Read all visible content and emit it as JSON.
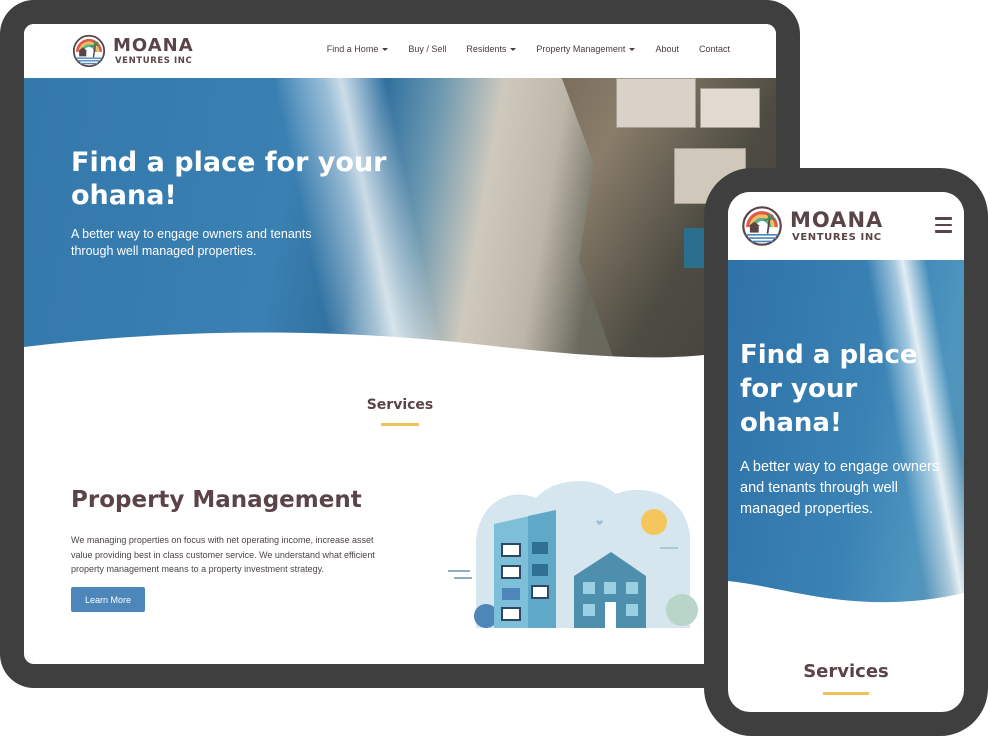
{
  "brand": {
    "name": "MOANA",
    "sub": "VENTURES INC"
  },
  "nav": {
    "items": [
      {
        "label": "Find a Home",
        "dropdown": true
      },
      {
        "label": "Buy / Sell",
        "dropdown": false
      },
      {
        "label": "Residents",
        "dropdown": true
      },
      {
        "label": "Property Management",
        "dropdown": true
      },
      {
        "label": "About",
        "dropdown": false
      },
      {
        "label": "Contact",
        "dropdown": false
      }
    ]
  },
  "hero": {
    "title": "Find a place for your ohana!",
    "subtitle": "A better way to engage owners and tenants through well managed properties."
  },
  "services": {
    "heading": "Services"
  },
  "feature": {
    "title": "Property Management",
    "body": "We managing properties on focus with net operating income, increase asset value providing best in class customer service. We understand what efficient property management means to a property investment strategy.",
    "button": "Learn More"
  },
  "colors": {
    "brand_text": "#5b4448",
    "accent_yellow": "#f0c05a",
    "button_blue": "#4d86b8",
    "device_frame": "#3f3f3f"
  },
  "icons": {
    "logo": "rainbow-palm-house-logo",
    "menu": "hamburger-icon",
    "dropdown": "caret-down-icon"
  }
}
